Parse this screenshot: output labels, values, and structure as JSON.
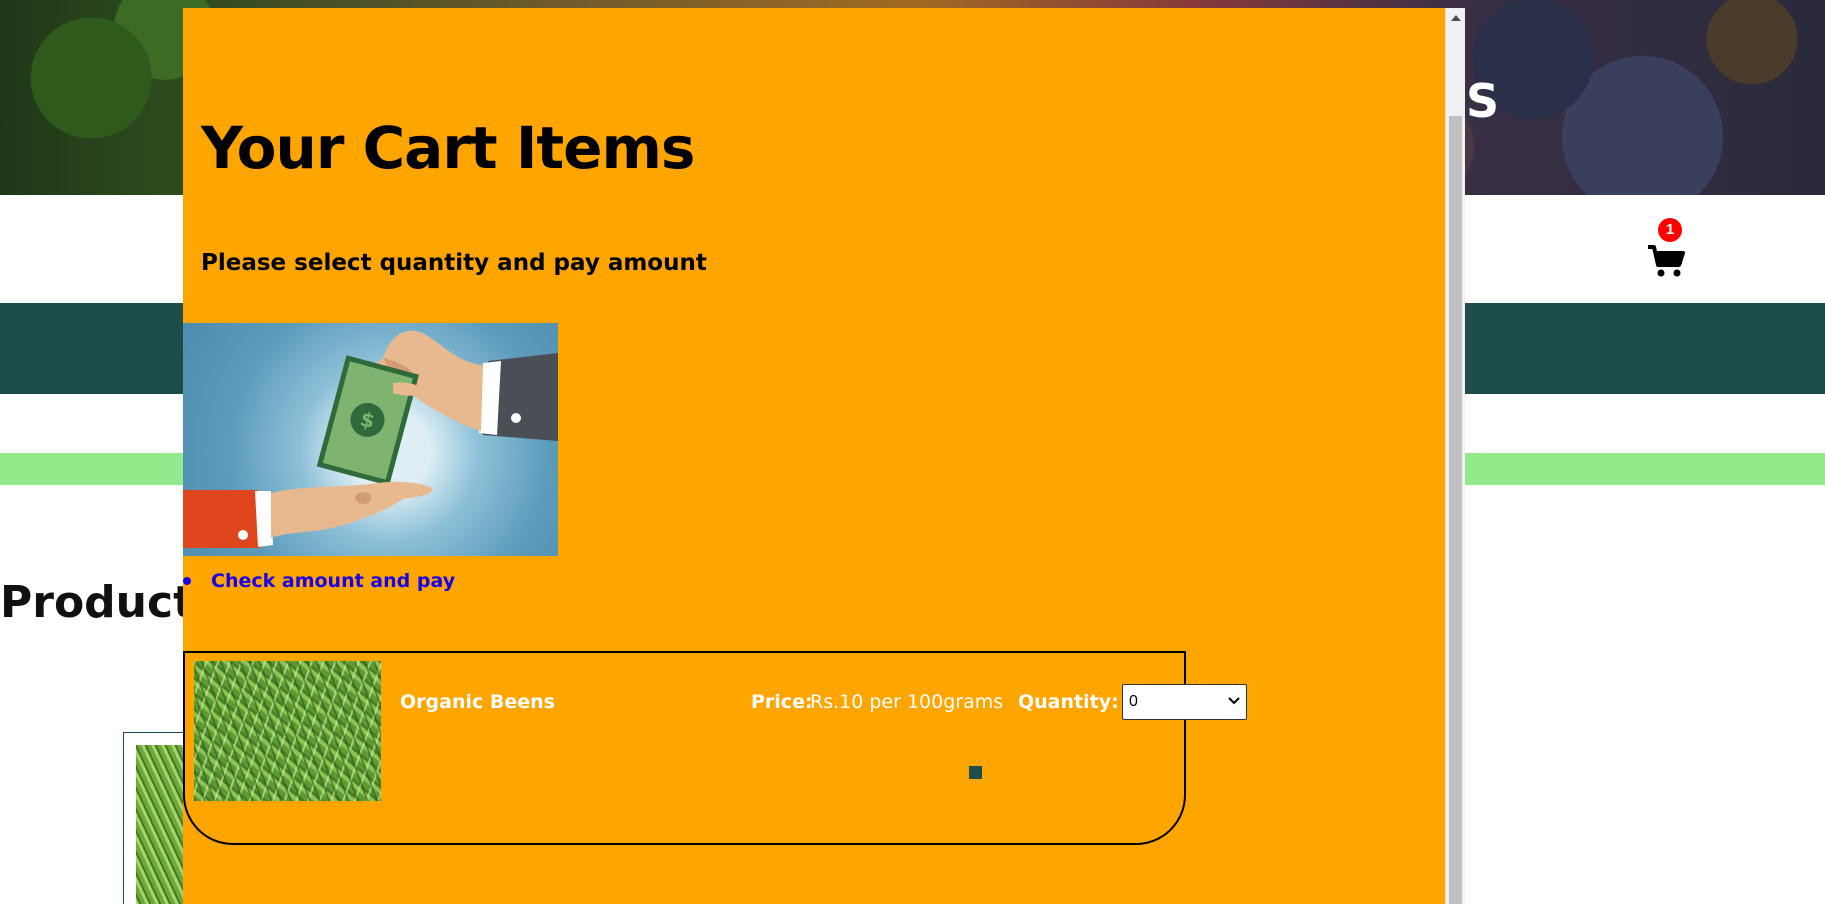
{
  "background": {
    "hero_text": "S",
    "cart": {
      "badge_count": "1",
      "icon": "shopping-cart-icon"
    },
    "products_heading": "Product"
  },
  "modal": {
    "title": "Your Cart Items",
    "subtitle": "Please select quantity and pay amount",
    "illustration": "money-handover-illustration",
    "list_link": "Check amount and pay",
    "item": {
      "name": "Organic Beens",
      "price_label": "Price:",
      "price_value": "Rs.10 per 100grams",
      "quantity_label": "Quantity:",
      "quantity_selected": "0"
    }
  },
  "colors": {
    "modal_bg": "#ffa500",
    "nav_band": "#1d4d4a",
    "green_strip": "#93ea8b",
    "link": "#1a00e6",
    "badge": "#ff0000"
  }
}
